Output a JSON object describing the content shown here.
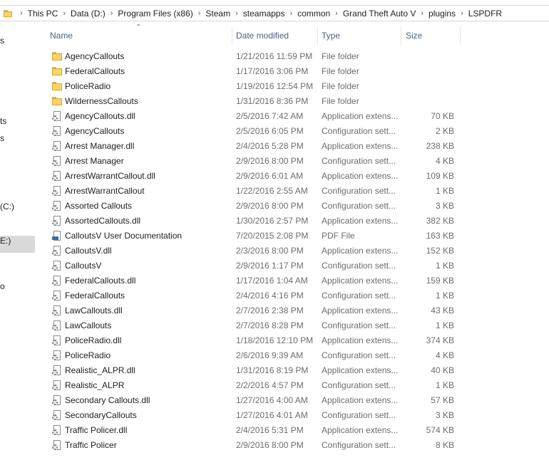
{
  "address": {
    "crumbs": [
      "This PC",
      "Data (D:)",
      "Program Files (x86)",
      "Steam",
      "steamapps",
      "common",
      "Grand Theft Auto V",
      "plugins",
      "LSPDFR"
    ]
  },
  "nav": {
    "fragments": [
      "s",
      "ts",
      "s",
      "(C:)",
      "E:)",
      "o"
    ]
  },
  "columns": {
    "name": "Name",
    "date": "Date modified",
    "type": "Type",
    "size": "Size"
  },
  "files": [
    {
      "name": "AgencyCallouts",
      "date": "1/21/2016 11:59 PM",
      "type": "File folder",
      "size": "",
      "icon": "folder-icon"
    },
    {
      "name": "FederalCallouts",
      "date": "1/17/2016 3:06 PM",
      "type": "File folder",
      "size": "",
      "icon": "folder-icon"
    },
    {
      "name": "PoliceRadio",
      "date": "1/19/2016 12:54 PM",
      "type": "File folder",
      "size": "",
      "icon": "folder-icon"
    },
    {
      "name": "WildernessCallouts",
      "date": "1/31/2016 8:36 PM",
      "type": "File folder",
      "size": "",
      "icon": "folder-icon"
    },
    {
      "name": "AgencyCallouts.dll",
      "date": "2/5/2016 7:42 AM",
      "type": "Application extens...",
      "size": "70 KB",
      "icon": "dll-file-icon"
    },
    {
      "name": "AgencyCallouts",
      "date": "2/5/2016 6:05 PM",
      "type": "Configuration sett...",
      "size": "2 KB",
      "icon": "config-file-icon"
    },
    {
      "name": "Arrest Manager.dll",
      "date": "2/4/2016 5:28 PM",
      "type": "Application extens...",
      "size": "238 KB",
      "icon": "dll-file-icon"
    },
    {
      "name": "Arrest Manager",
      "date": "2/9/2016 8:00 PM",
      "type": "Configuration sett...",
      "size": "4 KB",
      "icon": "config-file-icon"
    },
    {
      "name": "ArrestWarrantCallout.dll",
      "date": "2/9/2016 6:01 AM",
      "type": "Application extens...",
      "size": "109 KB",
      "icon": "dll-file-icon"
    },
    {
      "name": "ArrestWarrantCallout",
      "date": "1/22/2016 2:55 AM",
      "type": "Configuration sett...",
      "size": "1 KB",
      "icon": "config-file-icon"
    },
    {
      "name": "Assorted Callouts",
      "date": "2/9/2016 8:00 PM",
      "type": "Configuration sett...",
      "size": "3 KB",
      "icon": "config-file-icon"
    },
    {
      "name": "AssortedCallouts.dll",
      "date": "1/30/2016 2:57 PM",
      "type": "Application extens...",
      "size": "382 KB",
      "icon": "dll-file-icon"
    },
    {
      "name": "CalloutsV User Documentation",
      "date": "7/20/2015 2:08 PM",
      "type": "PDF File",
      "size": "163 KB",
      "icon": "pdf-file-icon"
    },
    {
      "name": "CalloutsV.dll",
      "date": "2/3/2016 8:00 PM",
      "type": "Application extens...",
      "size": "152 KB",
      "icon": "dll-file-icon"
    },
    {
      "name": "CalloutsV",
      "date": "2/9/2016 1:17 PM",
      "type": "Configuration sett...",
      "size": "1 KB",
      "icon": "config-file-icon"
    },
    {
      "name": "FederalCallouts.dll",
      "date": "1/17/2016 1:04 AM",
      "type": "Application extens...",
      "size": "159 KB",
      "icon": "dll-file-icon"
    },
    {
      "name": "FederalCallouts",
      "date": "2/4/2016 4:16 PM",
      "type": "Configuration sett...",
      "size": "1 KB",
      "icon": "config-file-icon"
    },
    {
      "name": "LawCallouts.dll",
      "date": "2/7/2016 2:38 PM",
      "type": "Application extens...",
      "size": "43 KB",
      "icon": "dll-file-icon"
    },
    {
      "name": "LawCallouts",
      "date": "2/7/2016 8:28 PM",
      "type": "Configuration sett...",
      "size": "1 KB",
      "icon": "config-file-icon"
    },
    {
      "name": "PoliceRadio.dll",
      "date": "1/18/2016 12:10 PM",
      "type": "Application extens...",
      "size": "374 KB",
      "icon": "dll-file-icon"
    },
    {
      "name": "PoliceRadio",
      "date": "2/6/2016 9:39 AM",
      "type": "Configuration sett...",
      "size": "4 KB",
      "icon": "config-file-icon"
    },
    {
      "name": "Realistic_ALPR.dll",
      "date": "1/31/2016 8:19 PM",
      "type": "Application extens...",
      "size": "40 KB",
      "icon": "dll-file-icon"
    },
    {
      "name": "Realistic_ALPR",
      "date": "2/2/2016 4:57 PM",
      "type": "Configuration sett...",
      "size": "1 KB",
      "icon": "config-file-icon"
    },
    {
      "name": "Secondary Callouts.dll",
      "date": "1/27/2016 4:00 AM",
      "type": "Application extens...",
      "size": "57 KB",
      "icon": "dll-file-icon"
    },
    {
      "name": "SecondaryCallouts",
      "date": "1/27/2016 4:01 AM",
      "type": "Configuration sett...",
      "size": "3 KB",
      "icon": "config-file-icon"
    },
    {
      "name": "Traffic Policer.dll",
      "date": "2/4/2016 5:31 PM",
      "type": "Application extens...",
      "size": "574 KB",
      "icon": "dll-file-icon"
    },
    {
      "name": "Traffic Policer",
      "date": "2/9/2016 8:00 PM",
      "type": "Configuration sett...",
      "size": "8 KB",
      "icon": "config-file-icon"
    }
  ]
}
